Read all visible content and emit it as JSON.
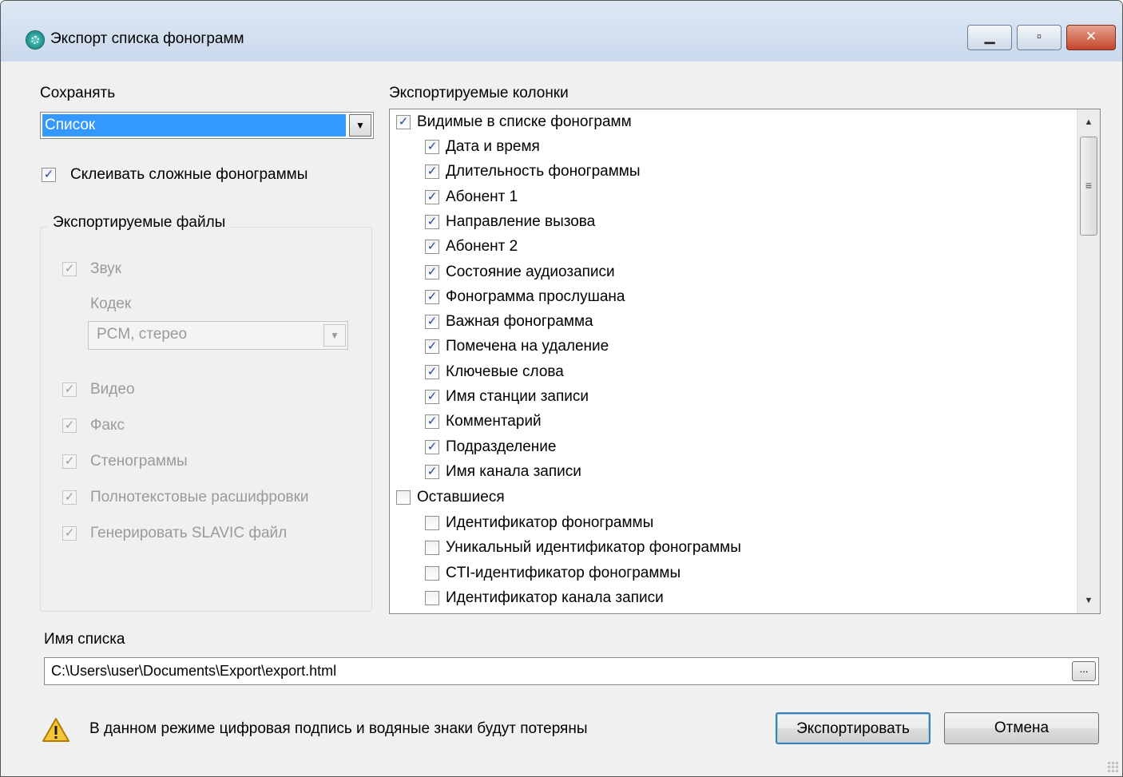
{
  "window": {
    "title": "Экспорт списка фонограмм"
  },
  "save": {
    "label": "Сохранять",
    "selected": "Список"
  },
  "merge_checkbox": {
    "label": "Склеивать сложные фонограммы",
    "checked": true
  },
  "files_group": {
    "title": "Экспортируемые файлы",
    "sound": "Звук",
    "codec_label": "Кодек",
    "codec_value": "PCM, стерео",
    "items": [
      "Видео",
      "Факс",
      "Стенограммы",
      "Полнотекстовые расшифровки",
      "Генерировать SLAVIC файл"
    ]
  },
  "columns": {
    "label": "Экспортируемые колонки",
    "visible_group": {
      "label": "Видимые в списке фонограмм",
      "checked": true,
      "items": [
        "Дата и время",
        "Длительность фонограммы",
        "Абонент 1",
        "Направление вызова",
        "Абонент 2",
        "Состояние аудиозаписи",
        "Фонограмма прослушана",
        "Важная фонограмма",
        "Помечена на удаление",
        "Ключевые слова",
        "Имя станции записи",
        "Комментарий",
        "Подразделение",
        "Имя канала записи"
      ]
    },
    "remaining_group": {
      "label": "Оставшиеся",
      "checked": false,
      "items": [
        "Идентификатор фонограммы",
        "Уникальный идентификатор фонограммы",
        "CTI-идентификатор фонограммы",
        "Идентификатор канала записи"
      ]
    }
  },
  "list_name": {
    "label": "Имя списка",
    "value": "C:\\Users\\user\\Documents\\Export\\export.html",
    "browse": "..."
  },
  "warning": "В данном режиме цифровая подпись и водяные знаки будут потеряны",
  "buttons": {
    "export": "Экспортировать",
    "cancel": "Отмена"
  }
}
